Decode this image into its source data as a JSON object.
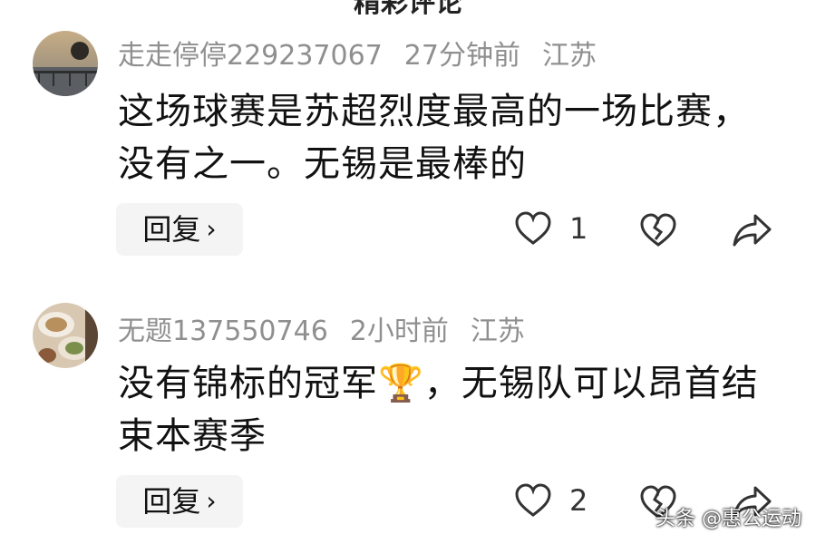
{
  "header": {
    "title": "精彩评论"
  },
  "comments": [
    {
      "username": "走走停停229237067",
      "time": "27分钟前",
      "location": "江苏",
      "text": "这场球赛是苏超烈度最高的一场比赛，没有之一。无锡是最棒的",
      "reply_label": "回复",
      "like_count": "1"
    },
    {
      "username": "无题137550746",
      "time": "2小时前",
      "location": "江苏",
      "text": "没有锦标的冠军🏆，无锡队可以昂首结束本赛季",
      "reply_label": "回复",
      "like_count": "2"
    }
  ],
  "icons": {
    "reply_chevron": "chevron-right-icon",
    "like": "heart-outline-icon",
    "dislike": "broken-heart-icon",
    "share": "share-arrow-icon"
  },
  "watermark": "头条 @惠公运动"
}
